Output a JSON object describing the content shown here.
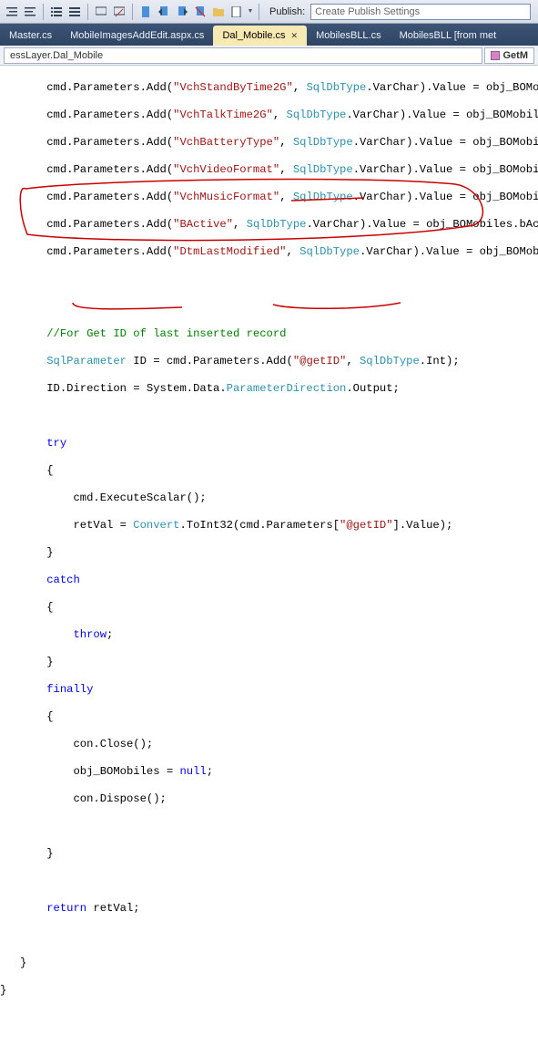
{
  "toolbar": {
    "publish_label": "Publish:",
    "publish_placeholder": "Create Publish Settings"
  },
  "tabs": [
    {
      "label": "Master.cs",
      "active": false
    },
    {
      "label": "MobileImagesAddEdit.aspx.cs",
      "active": false
    },
    {
      "label": "Dal_Mobile.cs",
      "active": true
    },
    {
      "label": "MobilesBLL.cs",
      "active": false
    },
    {
      "label": "MobilesBLL [from met",
      "active": false
    }
  ],
  "nav": {
    "left": "essLayer.Dal_Mobile",
    "right": "GetM"
  },
  "code": {
    "l1a": "       cmd.Parameters.Add(",
    "l1s": "\"VchStandByTime2G\"",
    "l1b": ", ",
    "l1t": "SqlDbType",
    "l1c": ".VarChar).Value = obj_BOMobile",
    "l2a": "       cmd.Parameters.Add(",
    "l2s": "\"VchTalkTime2G\"",
    "l2b": ", ",
    "l2t": "SqlDbType",
    "l2c": ".VarChar).Value = obj_BOMobiles",
    "l3a": "       cmd.Parameters.Add(",
    "l3s": "\"VchBatteryType\"",
    "l3b": ", ",
    "l3t": "SqlDbType",
    "l3c": ".VarChar).Value = obj_BOMobiles",
    "l4a": "       cmd.Parameters.Add(",
    "l4s": "\"VchVideoFormat\"",
    "l4b": ", ",
    "l4t": "SqlDbType",
    "l4c": ".VarChar).Value = obj_BOMobiles",
    "l5a": "       cmd.Parameters.Add(",
    "l5s": "\"VchMusicFormat\"",
    "l5b": ", ",
    "l5t": "SqlDbType",
    "l5c": ".VarChar).Value = obj_BOMobiles",
    "l6a": "       cmd.Parameters.Add(",
    "l6s": "\"BActive\"",
    "l6b": ", ",
    "l6t": "SqlDbType",
    "l6c": ".VarChar).Value = obj_BOMobiles.bActiv",
    "l7a": "       cmd.Parameters.Add(",
    "l7s": "\"DtmLastModified\"",
    "l7b": ", ",
    "l7t": "SqlDbType",
    "l7c": ".VarChar).Value = obj_BOMobile",
    "blank": "",
    "c1": "       //For Get ID of last inserted record",
    "p1a": "       ",
    "p1t1": "SqlParameter",
    "p1b": " ID = cmd.Parameters.Add(",
    "p1s": "\"@getID\"",
    "p1c": ", ",
    "p1t2": "SqlDbType",
    "p1d": ".Int);",
    "p2a": "       ID.Direction = System.Data.",
    "p2t": "ParameterDirection",
    "p2b": ".Output;",
    "tr1": "       ",
    "kw_try": "try",
    "ob": "       {",
    "ex1": "           cmd.ExecuteScalar();",
    "rv1": "           retVal = ",
    "rvT": "Convert",
    "rv2": ".ToInt32(cmd.Parameters[",
    "rvS": "\"@getID\"",
    "rv3": "].Value);",
    "cb": "       }",
    "kw_catch": "catch",
    "th": "           ",
    "kw_throw": "throw",
    "semi": ";",
    "kw_finally": "finally",
    "cc1": "           con.Close();",
    "cc2": "           obj_BOMobiles = ",
    "kw_null": "null",
    "cc3": "           con.Dispose();",
    "ret1": "       ",
    "kw_return": "return",
    "ret2": " retVal;",
    "cb2": "   }",
    "cb3": "}"
  }
}
